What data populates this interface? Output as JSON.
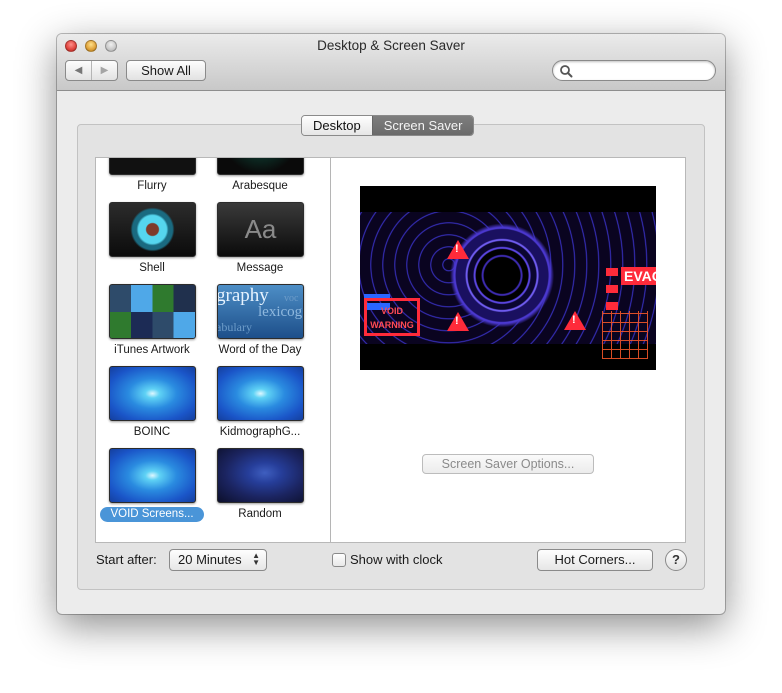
{
  "window": {
    "title": "Desktop & Screen Saver"
  },
  "toolbar": {
    "back_icon": "◀",
    "forward_icon": "▶",
    "show_all_label": "Show All",
    "search_placeholder": ""
  },
  "tabs": [
    {
      "label": "Desktop",
      "active": false
    },
    {
      "label": "Screen Saver",
      "active": true
    }
  ],
  "savers": [
    {
      "label": "Flurry",
      "thumb": "flurry"
    },
    {
      "label": "Arabesque",
      "thumb": "arabesque"
    },
    {
      "label": "Shell",
      "thumb": "shell"
    },
    {
      "label": "Message",
      "thumb": "message",
      "thumb_text": "Aa"
    },
    {
      "label": "iTunes Artwork",
      "thumb": "itunes"
    },
    {
      "label": "Word of the Day",
      "thumb": "word",
      "thumb_words": [
        "graphy",
        "voc",
        "lexicog",
        "abulary"
      ]
    },
    {
      "label": "BOINC",
      "thumb": "swirl"
    },
    {
      "label": "KidmographG...",
      "thumb": "swirl"
    },
    {
      "label": "VOID Screens...",
      "thumb": "swirl",
      "selected": true
    },
    {
      "label": "Random",
      "thumb": "random"
    }
  ],
  "preview": {
    "void_text": "VOID WARNING",
    "evac_text": "EVAC"
  },
  "options_button": {
    "label": "Screen Saver Options...",
    "enabled": false
  },
  "footer": {
    "start_after_label": "Start after:",
    "start_after_value": "20 Minutes",
    "show_clock_label": "Show with clock",
    "show_clock_checked": false,
    "hot_corners_label": "Hot Corners...",
    "help_label": "?"
  },
  "colors": {
    "selection": "#4a95d8",
    "active_tab": "#737373"
  }
}
